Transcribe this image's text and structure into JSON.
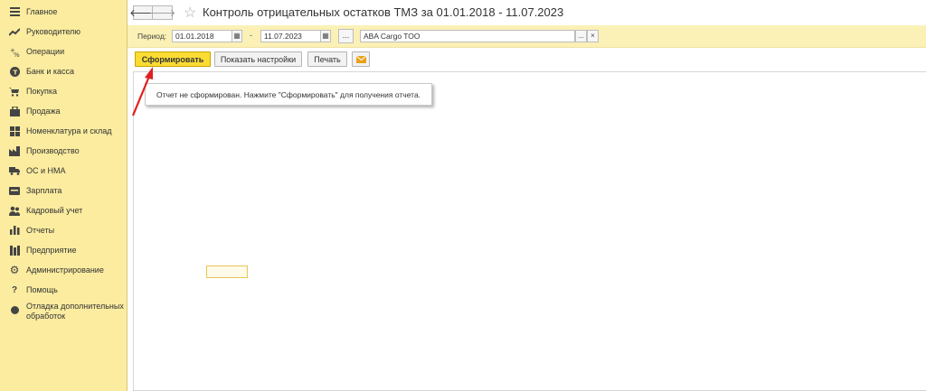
{
  "sidebar": {
    "items": [
      {
        "label": "Главное",
        "icon": "menu-icon"
      },
      {
        "label": "Руководителю",
        "icon": "trend-icon"
      },
      {
        "label": "Операции",
        "icon": "operations-icon"
      },
      {
        "label": "Банк и касса",
        "icon": "bank-icon"
      },
      {
        "label": "Покупка",
        "icon": "cart-icon"
      },
      {
        "label": "Продажа",
        "icon": "bag-icon"
      },
      {
        "label": "Номенклатура и склад",
        "icon": "warehouse-icon"
      },
      {
        "label": "Производство",
        "icon": "factory-icon"
      },
      {
        "label": "ОС и НМА",
        "icon": "truck-icon"
      },
      {
        "label": "Зарплата",
        "icon": "salary-icon"
      },
      {
        "label": "Кадровый учет",
        "icon": "people-icon"
      },
      {
        "label": "Отчеты",
        "icon": "chart-icon"
      },
      {
        "label": "Предприятие",
        "icon": "building-icon"
      },
      {
        "label": "Администрирование",
        "icon": "gear-icon"
      },
      {
        "label": "Помощь",
        "icon": "question-icon"
      },
      {
        "label": "Отладка дополнительных обработок",
        "icon": "circle-icon"
      }
    ]
  },
  "header": {
    "back_glyph": "🡐",
    "forward_glyph": "🡒",
    "title": "Контроль отрицательных остатков ТМЗ  за 01.01.2018 - 11.07.2023"
  },
  "params": {
    "period_label": "Период:",
    "date_from": "01.01.2018",
    "date_to": "11.07.2023",
    "dash": "-",
    "dots": "...",
    "organization": "ABA Cargo TOO",
    "org_dots": "...",
    "org_clear": "×"
  },
  "toolbar": {
    "generate_label": "Сформировать",
    "settings_label": "Показать настройки",
    "print_label": "Печать"
  },
  "report": {
    "message": "Отчет не сформирован. Нажмите \"Сформировать\" для получения отчета."
  },
  "colors": {
    "sidebar_bg": "#fbec9f",
    "params_bg": "#fbf1b6",
    "primary_button": "#fbdc33",
    "annotation_arrow": "#e02020"
  }
}
